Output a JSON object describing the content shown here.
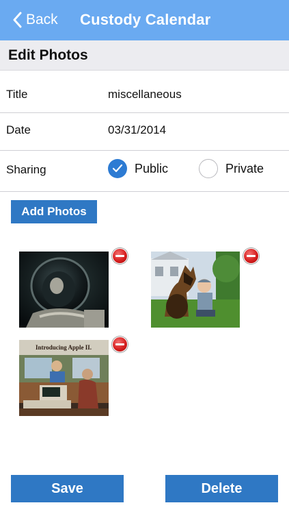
{
  "navbar": {
    "back_label": "Back",
    "title": "Custody Calendar",
    "back_icon": "chevron-left-icon"
  },
  "section": {
    "title": "Edit Photos"
  },
  "form": {
    "title_label": "Title",
    "title_value": "miscellaneous",
    "date_label": "Date",
    "date_value": "03/31/2014",
    "sharing_label": "Sharing",
    "sharing_options": [
      {
        "label": "Public",
        "selected": true
      },
      {
        "label": "Private",
        "selected": false
      }
    ]
  },
  "add_photos_label": "Add Photos",
  "photos": [
    {
      "name": "astronaut-helmet-photo"
    },
    {
      "name": "dog-and-child-photo"
    },
    {
      "name": "introducing-apple-ii-photo",
      "caption": "Introducing Apple II."
    }
  ],
  "actions": {
    "save_label": "Save",
    "delete_label": "Delete"
  },
  "colors": {
    "navbar": "#6aaaf1",
    "button": "#2f78c4",
    "radio_checked": "#2d7bd3",
    "remove": "#d61f1f"
  }
}
